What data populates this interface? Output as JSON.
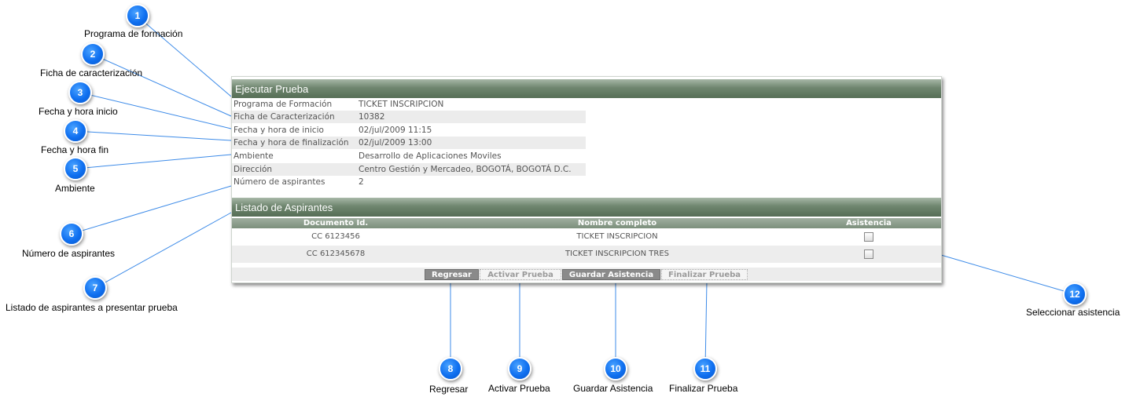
{
  "callouts": [
    {
      "num": "1",
      "label": "Programa de formación"
    },
    {
      "num": "2",
      "label": "Ficha de caracterización"
    },
    {
      "num": "3",
      "label": "Fecha y hora inicio"
    },
    {
      "num": "4",
      "label": "Fecha y hora fin"
    },
    {
      "num": "5",
      "label": "Ambiente"
    },
    {
      "num": "6",
      "label": "Número de aspirantes"
    },
    {
      "num": "7",
      "label": "Listado de aspirantes a presentar prueba"
    },
    {
      "num": "8",
      "label": "Regresar"
    },
    {
      "num": "9",
      "label": "Activar Prueba"
    },
    {
      "num": "10",
      "label": "Guardar Asistencia"
    },
    {
      "num": "11",
      "label": "Finalizar Prueba"
    },
    {
      "num": "12",
      "label": "Seleccionar asistencia"
    }
  ],
  "panel": {
    "title": "Ejecutar Prueba",
    "fields": [
      {
        "key": "Programa de Formación",
        "value": "TICKET INSCRIPCION"
      },
      {
        "key": "Ficha de Caracterización",
        "value": "10382"
      },
      {
        "key": "Fecha y hora de inicio",
        "value": "02/jul/2009 11:15"
      },
      {
        "key": "Fecha y hora de finalización",
        "value": "02/jul/2009 13:00"
      },
      {
        "key": "Ambiente",
        "value": "Desarrollo de Aplicaciones Moviles"
      },
      {
        "key": "Dirección",
        "value": "Centro Gestión y Mercadeo, BOGOTÁ, BOGOTÁ D.C."
      },
      {
        "key": "Número de aspirantes",
        "value": "2"
      }
    ]
  },
  "listado": {
    "title": "Listado de Aspirantes",
    "columns": [
      "Documento Id.",
      "Nombre completo",
      "Asistencia"
    ],
    "rows": [
      {
        "documento": "CC 6123456",
        "nombre": "TICKET INSCRIPCION",
        "asistencia": false
      },
      {
        "documento": "CC 612345678",
        "nombre": "TICKET INSCRIPCION TRES",
        "asistencia": false
      }
    ]
  },
  "buttons": {
    "regresar": "Regresar",
    "activar": "Activar Prueba",
    "guardar": "Guardar Asistencia",
    "finalizar": "Finalizar Prueba"
  }
}
